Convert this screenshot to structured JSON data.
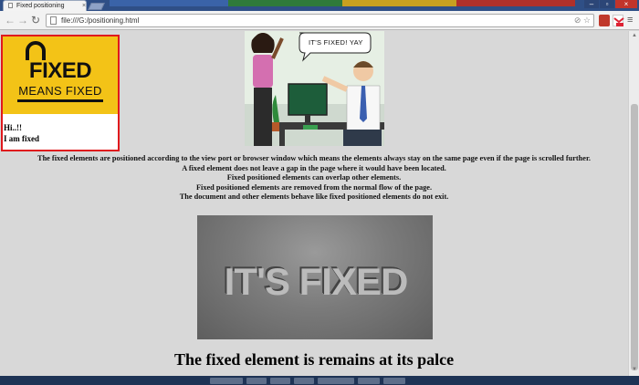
{
  "colors": {
    "tabstrip": "#2f4f86",
    "accent_red": "#e0191d",
    "logo_yellow": "#f3c317",
    "page_bg": "#d8d8d8"
  },
  "browser": {
    "tab_title": "Fixed positioning",
    "tab_close": "×",
    "url": "file:///G:/positioning.html",
    "icons": [
      "back-icon",
      "forward-icon",
      "reload-icon",
      "page-icon",
      "cookie-icon",
      "star-icon",
      "extension-icon",
      "gmail-icon",
      "menu-icon"
    ],
    "window_controls": {
      "minimize": "–",
      "maximize": "▫",
      "close": "×"
    },
    "nav": {
      "back": "←",
      "forward": "→",
      "reload": "↻",
      "menu": "≡"
    },
    "omnibox_icons": "⊘ ☆"
  },
  "page": {
    "fixed_box": {
      "logo_word": "FIXED",
      "logo_sub": "MEANS FIXED",
      "line1": "Hi..!!",
      "line2": "I am fixed"
    },
    "comic_speech": "IT'S FIXED! YAY",
    "paragraphs": [
      "The fixed elements are positioned according to the view port or browser window which means the elements always stay on the same page even if the page is scrolled further.",
      "A fixed element does not leave a gap in the page where it would have been located.",
      "Fixed positioned elements can overlap other elements.",
      "Fixed positioned elements are removed from the normal flow of the page.",
      "The document and other elements behave like fixed positioned elements do not exit."
    ],
    "banner_text": "IT'S FIXED",
    "heading": "The fixed element is remains at its palce"
  }
}
